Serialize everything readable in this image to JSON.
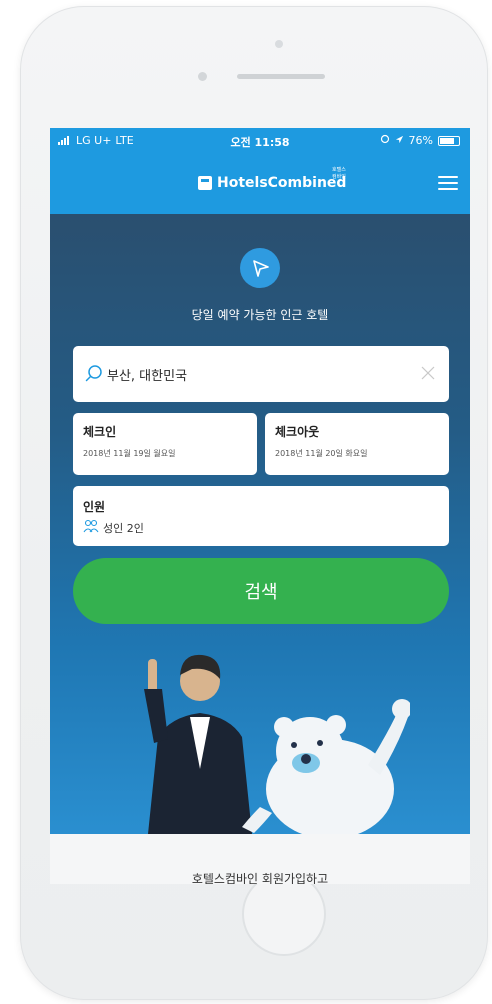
{
  "status_bar": {
    "carrier": "LG U+",
    "network": "LTE",
    "time": "오전 11:58",
    "battery": "76%"
  },
  "header": {
    "logo_part1": "Hotels",
    "logo_part2": "Combined",
    "logo_sub": "호텔스컴바인",
    "menu_icon": "hamburger-menu-icon"
  },
  "hero": {
    "nearby_icon": "location-arrow-icon",
    "nearby_text": "당일 예약 가능한 인근 호텔"
  },
  "search_form": {
    "destination": "부산, 대한민국",
    "checkin_label": "체크인",
    "checkin_value": "2018년 11월 19일 월요일",
    "checkout_label": "체크아웃",
    "checkout_value": "2018년 11월 20일 화요일",
    "guests_label": "인원",
    "guests_value": "성인 2인",
    "search_button": "검색"
  },
  "footer": {
    "text": "호텔스컴바인 회원가입하고"
  },
  "colors": {
    "header_blue": "#1e9ae0",
    "hero_dark": "#245c86",
    "search_green": "#34b14f"
  }
}
